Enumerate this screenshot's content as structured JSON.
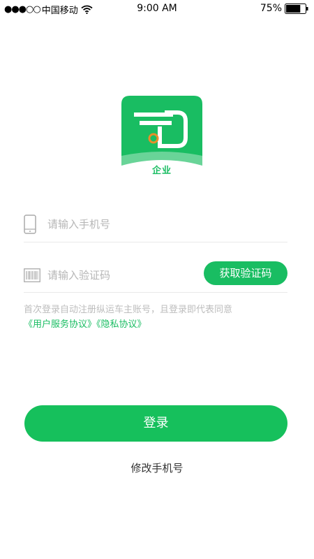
{
  "status_bar": {
    "signal": "●●●○○",
    "carrier": "中国移动",
    "time": "9:00 AM",
    "battery_percent": "75%",
    "battery_level": 0.75
  },
  "logo": {
    "caption": "企业"
  },
  "form": {
    "phone_placeholder": "请输入手机号",
    "code_placeholder": "请输入验证码",
    "get_code_label": "获取验证码"
  },
  "agreement": {
    "text": "首次登录自动注册纵运车主账号，且登录即代表同意",
    "user_agreement": "《用户服务协议》",
    "privacy_policy": "《隐私协议》"
  },
  "actions": {
    "login_label": "登录",
    "change_phone_label": "修改手机号"
  },
  "colors": {
    "brand": "#19bd62",
    "placeholder": "#b6b6b6",
    "divider": "#e9e9e9"
  },
  "icons": [
    "wifi-icon",
    "battery-icon",
    "phone-icon",
    "barcode-icon",
    "app-logo"
  ]
}
